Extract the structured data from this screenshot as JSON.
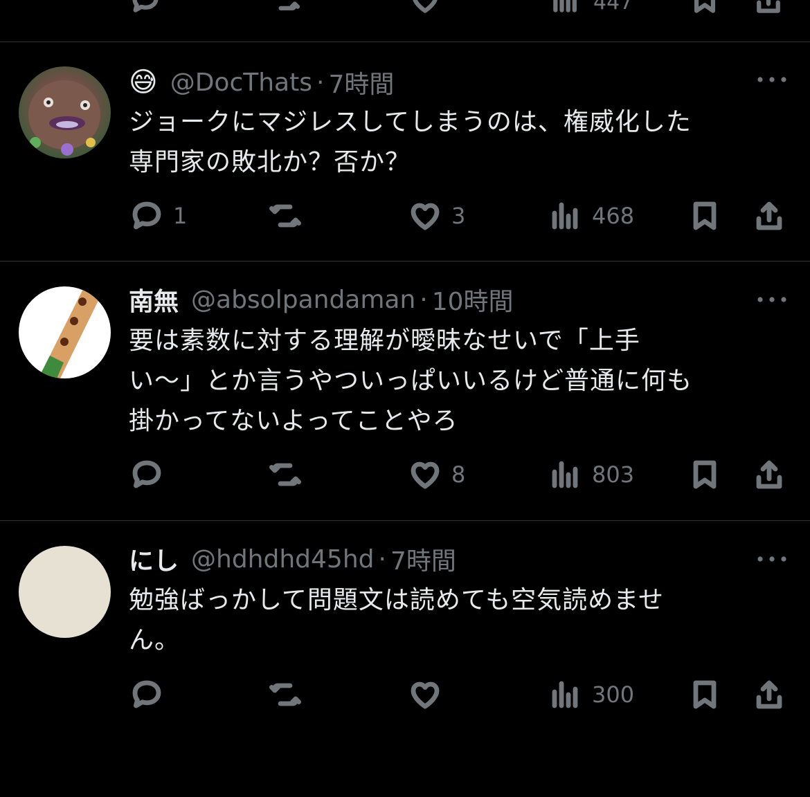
{
  "top_partial": {
    "views": "447"
  },
  "tweets": [
    {
      "emoji": "😅",
      "name": "",
      "handle": "@DocThats",
      "dot": "·",
      "time": "7時間",
      "lines": [
        "ジョークにマジレスしてしまうのは、権威化した",
        "専門家の敗北か？否か？"
      ],
      "replies": "1",
      "retweets": "",
      "likes": "3",
      "views": "468"
    },
    {
      "name": "南無",
      "handle": "@absolpandaman",
      "dot": "·",
      "time": "10時間",
      "lines": [
        "要は素数に対する理解が曖昧なせいで「上手",
        "い〜」とか言うやついっぱいいるけど普通に何も",
        "掛かってないよってことやろ"
      ],
      "replies": "",
      "retweets": "",
      "likes": "8",
      "views": "803"
    },
    {
      "name": "にし",
      "handle": "@hdhdhd45hd",
      "dot": "·",
      "time": "7時間",
      "lines": [
        "勉強ばっかして問題文は読めても空気読めませ",
        "ん。"
      ],
      "replies": "",
      "retweets": "",
      "likes": "",
      "views": "300"
    }
  ],
  "icons": {
    "reply": "reply-icon",
    "retweet": "retweet-icon",
    "like": "heart-icon",
    "views": "views-bar-chart-icon",
    "bookmark": "bookmark-icon",
    "share": "share-icon",
    "more": "more-dots-icon"
  },
  "colors": {
    "background": "#000000",
    "text": "#e7e9ea",
    "muted": "#71767b",
    "divider": "#2f3336"
  }
}
